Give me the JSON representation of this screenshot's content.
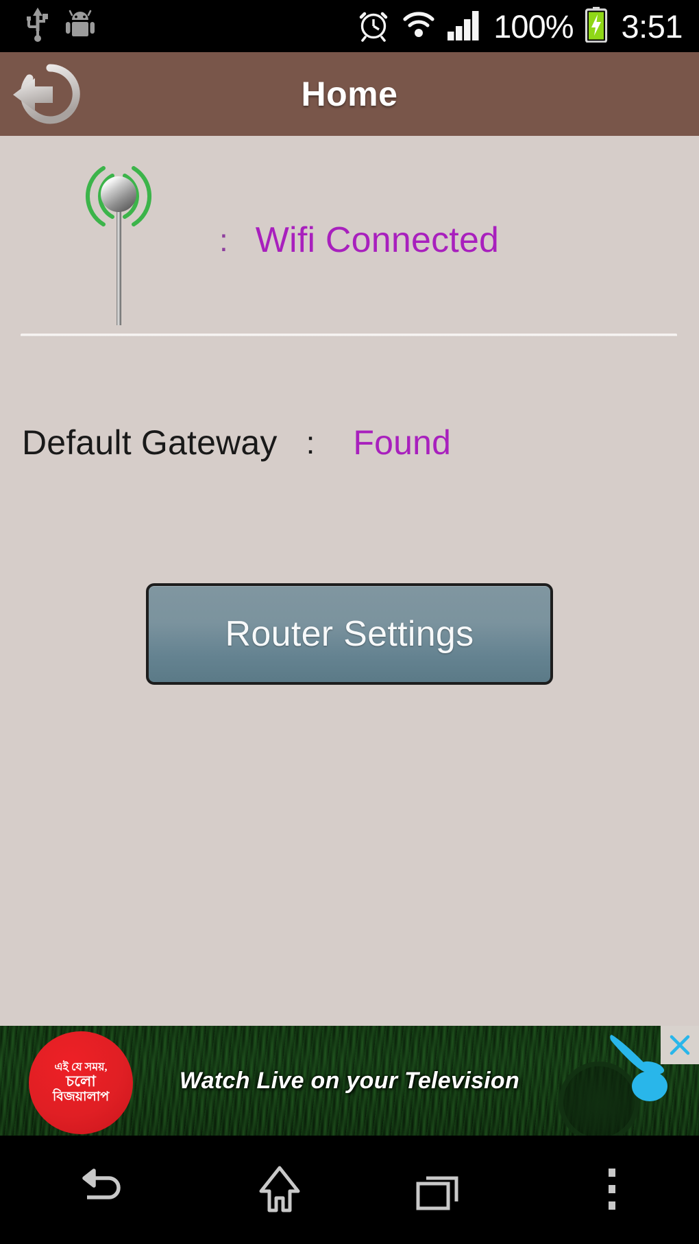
{
  "status_bar": {
    "icons_left": [
      "usb-icon",
      "android-robot-icon"
    ],
    "icons_right": [
      "alarm-clock-icon",
      "wifi-icon",
      "signal-bars-icon"
    ],
    "battery_percent": "100%",
    "battery_icon": "battery-charging-icon",
    "clock": "3:51"
  },
  "action_bar": {
    "back_icon": "back-circle-arrow-icon",
    "title": "Home",
    "background_color": "#79564a"
  },
  "main": {
    "wifi": {
      "icon": "antenna-signal-icon",
      "separator": ":",
      "status": "Wifi Connected",
      "status_color": "#a820bd",
      "signal_arc_color": "#3cb44a"
    },
    "gateway": {
      "label": "Default Gateway",
      "separator": ":",
      "value": "Found",
      "value_color": "#a820bd"
    },
    "router_button": {
      "label": "Router Settings",
      "background_color": "#6c8793"
    },
    "background_color": "#d6cdc9"
  },
  "ad_banner": {
    "brand_text_line1": "এই যে সময়,",
    "brand_text_line2": "চলো",
    "brand_text_line3": "বিজয়ালাপ",
    "headline": "Watch Live on your Television",
    "logo_icon": "robi-swoosh-logo-icon",
    "close_icon": "close-x-icon",
    "brand_circle_color": "#e01f24"
  },
  "nav_bar": {
    "back_icon": "nav-back-icon",
    "home_icon": "nav-home-icon",
    "recents_icon": "nav-recents-icon",
    "menu_icon": "nav-overflow-menu-icon"
  }
}
